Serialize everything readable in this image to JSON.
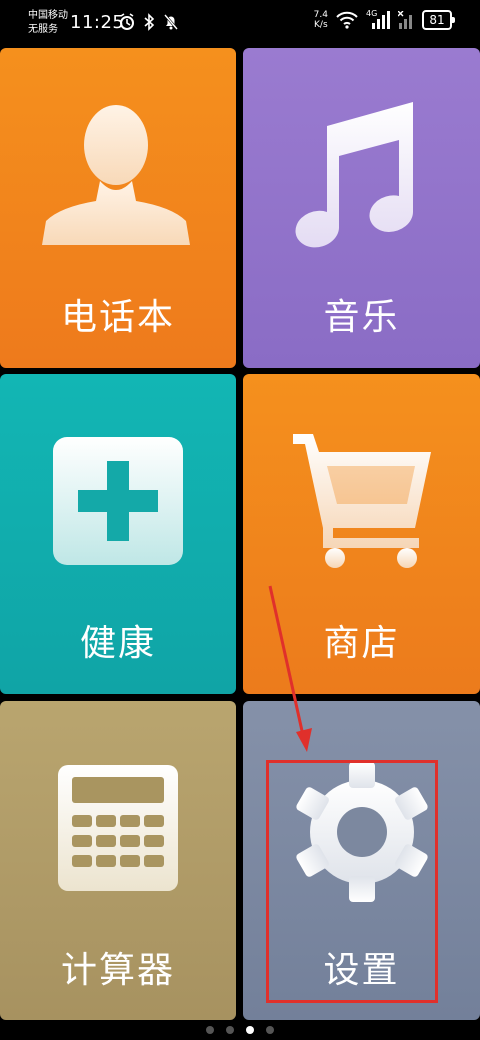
{
  "status_bar": {
    "carrier_line1": "中国移动",
    "carrier_line2": "无服务",
    "time": "11:25",
    "net_speed_value": "7.4",
    "net_speed_unit": "K/s",
    "network_type": "4G",
    "battery": "81",
    "icons": [
      "alarm-icon",
      "bluetooth-icon",
      "mute-bell-icon",
      "wifi-icon",
      "signal-icon",
      "battery-icon"
    ]
  },
  "tiles": [
    {
      "label": "电话本",
      "icon": "contact-person-icon",
      "color": "#F28A1C"
    },
    {
      "label": "音乐",
      "icon": "music-note-icon",
      "color": "#9475CB"
    },
    {
      "label": "健康",
      "icon": "health-plus-icon",
      "color": "#12AFAE"
    },
    {
      "label": "商店",
      "icon": "shopping-cart-icon",
      "color": "#F28A1C"
    },
    {
      "label": "计算器",
      "icon": "calculator-icon",
      "color": "#B09D68"
    },
    {
      "label": "设置",
      "icon": "gear-icon",
      "color": "#7D8AA2"
    }
  ],
  "annotation": {
    "color": "#E0302B"
  },
  "page_indicator": {
    "total": 4,
    "active_index": 2
  }
}
